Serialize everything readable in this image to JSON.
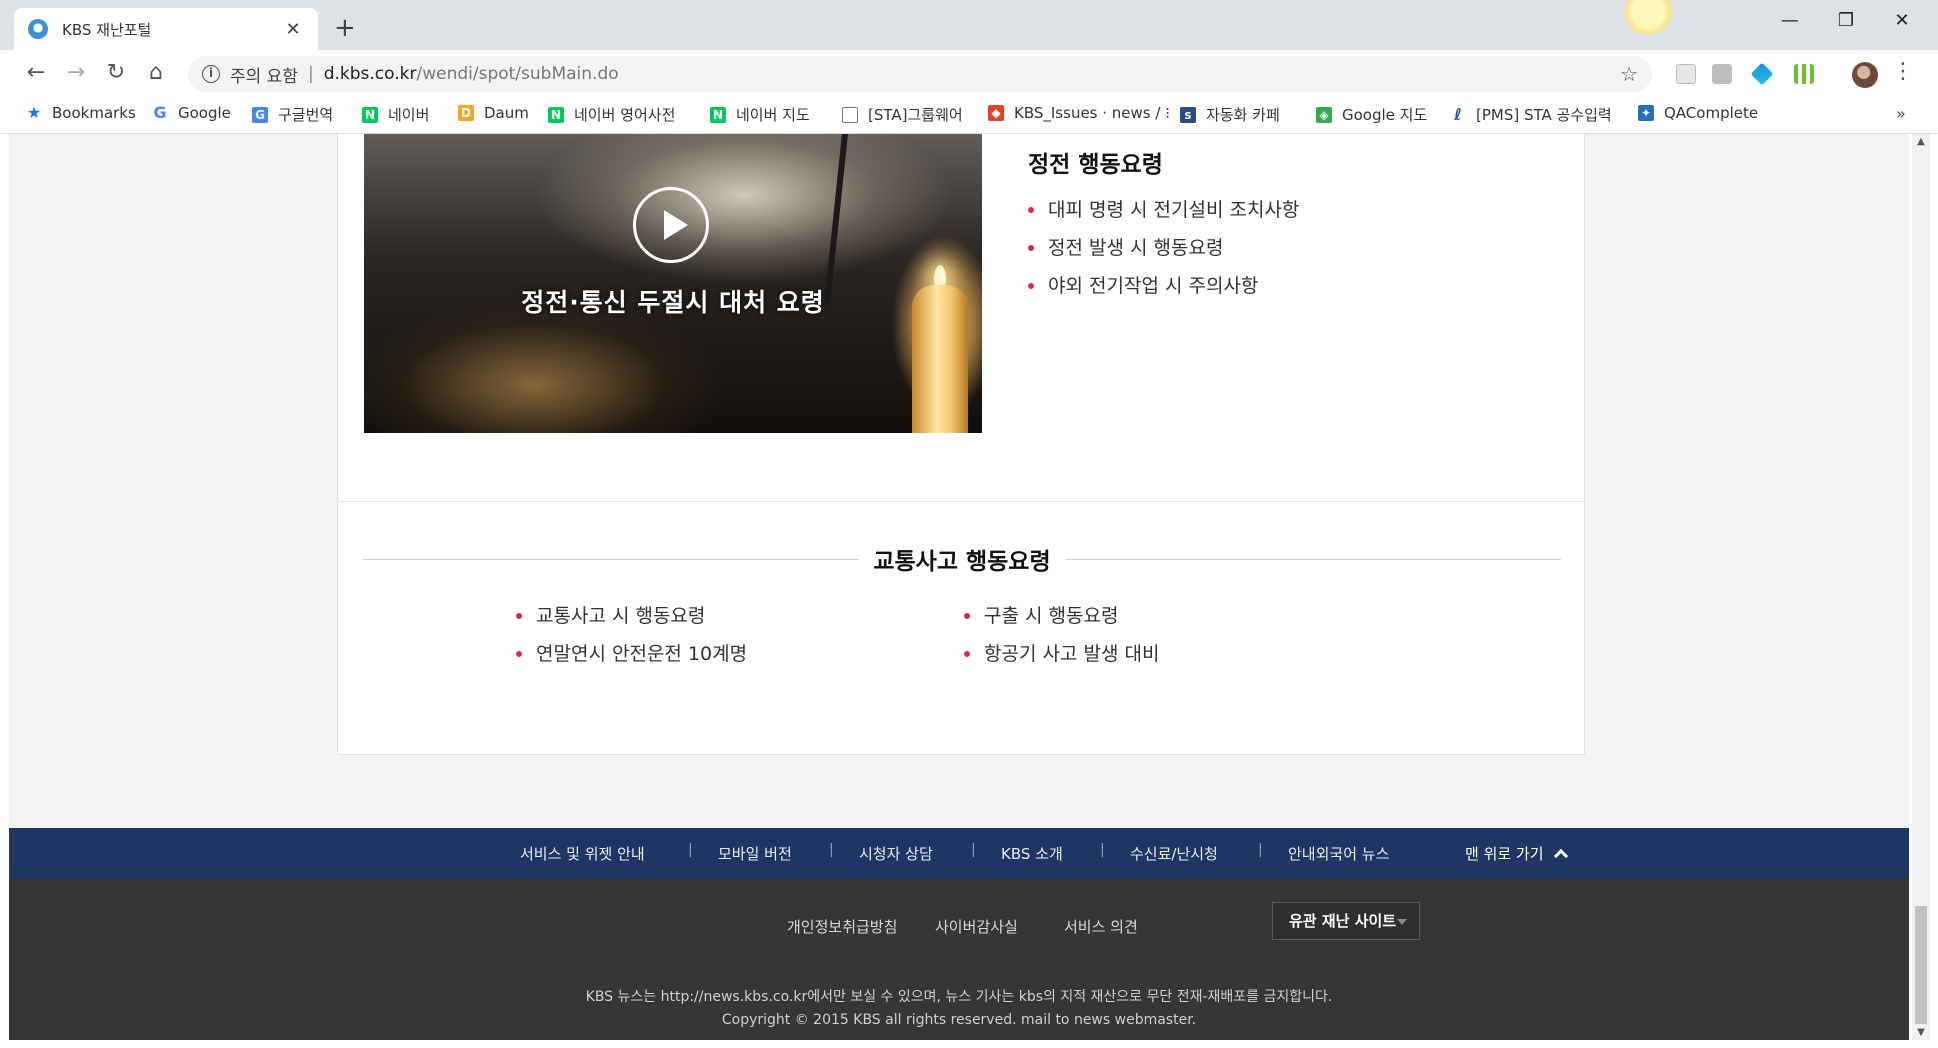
{
  "browser": {
    "tab_title": "KBS 재난포털",
    "tab_close": "✕",
    "new_tab": "+",
    "window_controls": {
      "minimize": "—",
      "restore": "❐",
      "close": "✕"
    },
    "nav": {
      "back": "←",
      "forward": "→",
      "reload": "↻",
      "home": "⌂"
    },
    "address": {
      "info": "i",
      "warning": "주의 요함",
      "separator": "|",
      "host": "d.kbs.co.kr",
      "path": "/wendi/spot/subMain.do",
      "bookmark_star": "☆"
    },
    "menu": "⋮",
    "bookmarks": [
      {
        "label": "Bookmarks",
        "icon": "star-icon",
        "color": "#1a73e8"
      },
      {
        "label": "Google",
        "icon": "google-icon",
        "color": "#4285f4"
      },
      {
        "label": "구글번역",
        "icon": "translate-icon",
        "color": "#4285f4"
      },
      {
        "label": "네이버",
        "icon": "naver-icon",
        "color": "#03c75a"
      },
      {
        "label": "Daum",
        "icon": "daum-icon",
        "color": "#f5a623"
      },
      {
        "label": "네이버 영어사전",
        "icon": "naver-dict-icon",
        "color": "#03c75a"
      },
      {
        "label": "네이버 지도",
        "icon": "naver-map-icon",
        "color": "#03c75a"
      },
      {
        "label": "[STA]그룹웨어",
        "icon": "page-icon",
        "color": "#777777"
      },
      {
        "label": "KBS_Issues · news / ⁝",
        "icon": "gitlab-icon",
        "color": "#e24329"
      },
      {
        "label": "자동화 카페",
        "icon": "cafe-icon",
        "color": "#2a4b8d"
      },
      {
        "label": "Google 지도",
        "icon": "google-maps-icon",
        "color": "#34a853"
      },
      {
        "label": "[PMS] STA 공수입력",
        "icon": "pms-icon",
        "color": "#2a4b8d"
      },
      {
        "label": "QAComplete",
        "icon": "qacomplete-icon",
        "color": "#2a6fb8"
      }
    ],
    "bookmarks_more": "»"
  },
  "power_outage": {
    "video_caption": "정전·통신 두절시 대처 요령",
    "title": "정전 행동요령",
    "items": [
      "대피 명령 시 전기설비 조치사항",
      "정전 발생 시 행동요령",
      "야외 전기작업 시 주의사항"
    ]
  },
  "traffic": {
    "title": "교통사고 행동요령",
    "left_items": [
      "교통사고 시 행동요령",
      "연말연시 안전운전 10계명"
    ],
    "right_items": [
      "구출 시 행동요령",
      "항공기 사고 발생 대비"
    ]
  },
  "footer": {
    "nav": [
      "서비스 및 위젯 안내",
      "모바일 버전",
      "시청자 상담",
      "KBS 소개",
      "수신료/난시청",
      "안내외국어 뉴스"
    ],
    "nav_separator": "|",
    "to_top": "맨 위로 가기",
    "links": [
      "개인정보취급방침",
      "사이버감사실",
      "서비스 의견"
    ],
    "related_sites": "유관 재난 사이트",
    "notice": "KBS 뉴스는 http://news.kbs.co.kr에서만 보실 수 있으며, 뉴스 기사는 kbs의 지적 재산으로 무단 전재-재배포를 금지합니다.",
    "copyright": "Copyright © 2015 KBS all rights reserved. mail to news webmaster."
  },
  "colors": {
    "accent_bullet": "#e0264c",
    "footer_nav_bg": "#1f3564",
    "footer_bg": "#363636",
    "page_bg": "#f3f3f3"
  }
}
